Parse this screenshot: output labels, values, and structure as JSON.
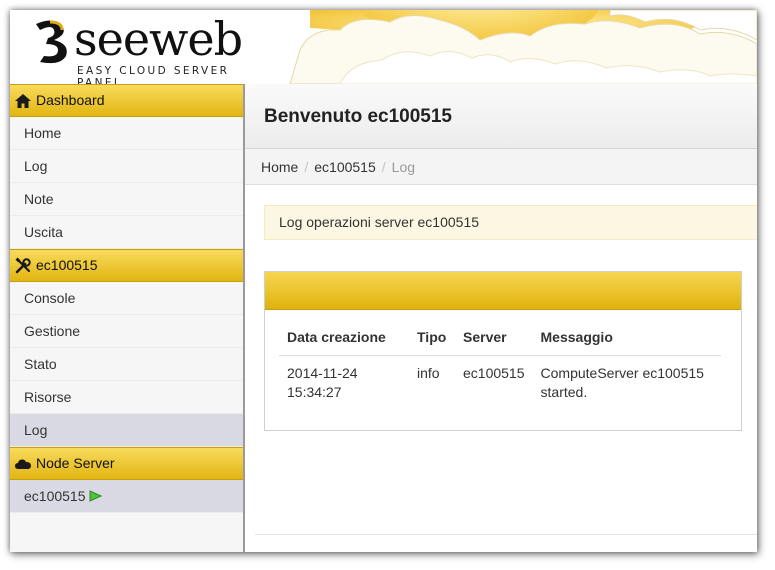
{
  "brand": {
    "name": "seeweb",
    "tagline": "EASY CLOUD SERVER PANEL",
    "accent": "#e8bd1a"
  },
  "sidebar": {
    "sections": [
      {
        "title": "Dashboard",
        "icon": "home-icon",
        "items": [
          {
            "label": "Home"
          },
          {
            "label": "Log"
          },
          {
            "label": "Note"
          },
          {
            "label": "Uscita"
          }
        ]
      },
      {
        "title": "ec100515",
        "icon": "tools-icon",
        "items": [
          {
            "label": "Console"
          },
          {
            "label": "Gestione"
          },
          {
            "label": "Stato"
          },
          {
            "label": "Risorse"
          },
          {
            "label": "Log",
            "active": true
          }
        ]
      },
      {
        "title": "Node Server",
        "icon": "cloud-icon",
        "items": [
          {
            "label": "ec100515",
            "status_icon": "play-icon"
          }
        ]
      }
    ]
  },
  "main": {
    "title": "Benvenuto ec100515",
    "breadcrumb": [
      "Home",
      "ec100515",
      "Log"
    ],
    "alert": "Log operazioni server ec100515",
    "table": {
      "headers": [
        "Data creazione",
        "Tipo",
        "Server",
        "Messaggio"
      ],
      "rows": [
        {
          "date_line1": "2014-11-24",
          "date_line2": "15:34:27",
          "tipo": "info",
          "server": "ec100515",
          "msg_line1": "ComputeServer ec100515",
          "msg_line2": "started."
        }
      ]
    }
  }
}
